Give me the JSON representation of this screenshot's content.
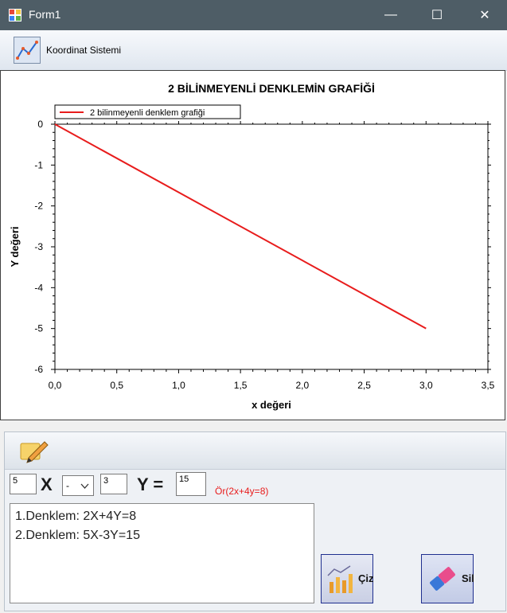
{
  "window": {
    "title": "Form1",
    "minimize": "—",
    "maximize": "☐",
    "close": "✕"
  },
  "toolbar": {
    "label": "Koordinat Sistemi"
  },
  "chart_data": {
    "type": "line",
    "title": "2 BİLİNMEYENLİ DENKLEMİN GRAFİĞİ",
    "xlabel": "x değeri",
    "ylabel": "Y değeri",
    "xlim": [
      0,
      3.5
    ],
    "ylim": [
      -6,
      0
    ],
    "x_ticks": [
      "0,0",
      "0,5",
      "1,0",
      "1,5",
      "2,0",
      "2,5",
      "3,0",
      "3,5"
    ],
    "y_ticks": [
      "0",
      "-1",
      "-2",
      "-3",
      "-4",
      "-5",
      "-6"
    ],
    "legend": "top-left",
    "series": [
      {
        "name": "2 bilinmeyenli denklem grafiği",
        "color": "#e81c1c",
        "x": [
          0,
          3
        ],
        "y": [
          0,
          -5
        ]
      }
    ]
  },
  "inputs": {
    "x_coef": "5",
    "x_label": "X",
    "operator": "-",
    "y_coef": "3",
    "y_label": "Y =",
    "rhs": "15",
    "example": "Ör(2x+4y=8)"
  },
  "equations": [
    "1.Denklem: 2X+4Y=8",
    "2.Denklem: 5X-3Y=15"
  ],
  "buttons": {
    "draw": "Çiz",
    "clear": "Sil"
  }
}
